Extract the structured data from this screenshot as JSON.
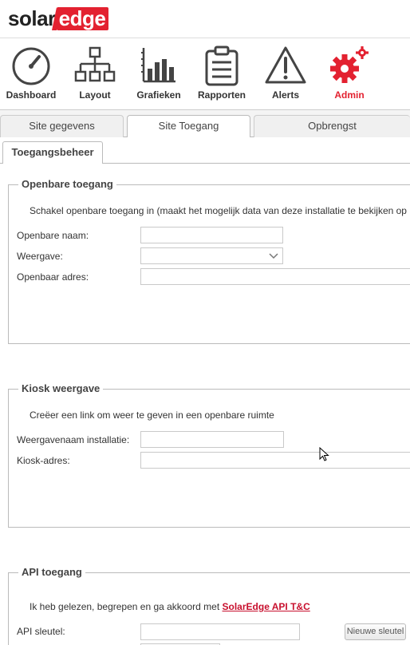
{
  "brand": {
    "part1": "solar",
    "part2": "edge",
    "accent": "#e32130"
  },
  "nav": {
    "dashboard": "Dashboard",
    "layout": "Layout",
    "grafieken": "Grafieken",
    "rapporten": "Rapporten",
    "alerts": "Alerts",
    "admin": "Admin"
  },
  "tabs": {
    "site_gegevens": "Site gegevens",
    "site_toegang": "Site Toegang",
    "opbrengst": "Opbrengst"
  },
  "subtab": "Toegangsbeheer",
  "public_access": {
    "legend": "Openbare toegang",
    "desc": "Schakel openbare toegang in (maakt het mogelijk data van deze installatie te bekijken op",
    "name_label": "Openbare naam:",
    "name_value": "",
    "view_label": "Weergave:",
    "view_value": "",
    "address_label": "Openbaar adres:",
    "address_value": ""
  },
  "kiosk": {
    "legend": "Kiosk weergave",
    "desc": "Creëer een link om weer te geven in een openbare ruimte",
    "name_label": "Weergavenaam installatie:",
    "name_value": "",
    "address_label": "Kiosk-adres:",
    "address_value": ""
  },
  "api": {
    "legend": "API toegang",
    "desc_prefix": "Ik heb gelezen, begrepen en ga akkoord met",
    "desc_link": "SolarEdge API T&C",
    "key_label": "API sleutel:",
    "key_value": "",
    "new_key_button": "Nieuwe sleutel"
  }
}
